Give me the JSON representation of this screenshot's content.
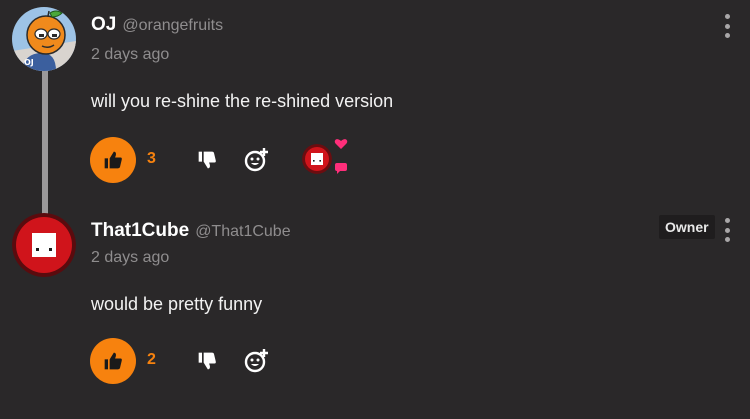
{
  "comments": [
    {
      "author": "OJ",
      "handle": "@orangefruits",
      "timestamp": "2 days ago",
      "text": "will you re-shine the re-shined version",
      "likes": "3"
    },
    {
      "author": "That1Cube",
      "handle": "@That1Cube",
      "timestamp": "2 days ago",
      "text": "would be pretty funny",
      "likes": "2",
      "badge": "Owner"
    }
  ],
  "avatar_1_label": "OJ",
  "colors": {
    "background": "#2a2829",
    "accent": "#f7820e",
    "muted_text": "#8f8d8e",
    "heart": "#ff2e7a",
    "cube_red": "#d0141b"
  },
  "icons": {
    "like": "thumbs-up-icon",
    "dislike": "thumbs-down-icon",
    "react": "add-reaction-icon",
    "menu": "more-vertical-icon",
    "creator_heart": "heart-icon"
  }
}
